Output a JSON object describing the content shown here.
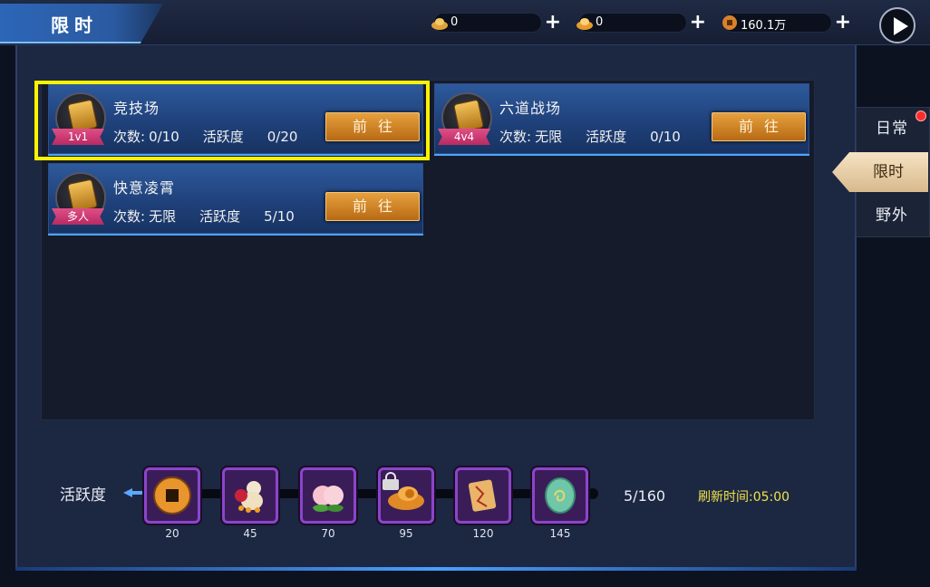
{
  "header": {
    "title": "限时",
    "resources": [
      {
        "icon": "silver-ingot-icon",
        "value": "0"
      },
      {
        "icon": "gold-ingot-icon",
        "value": "0"
      },
      {
        "icon": "coin-icon",
        "value": "160.1万"
      }
    ],
    "plus_label": "+"
  },
  "cards": [
    {
      "name": "arena",
      "title": "竞技场",
      "tag": "1v1",
      "count_label": "次数:",
      "count_value": "0/10",
      "activity_label": "活跃度",
      "activity_value": "0/20",
      "button": "前往"
    },
    {
      "name": "six-paths-battlefield",
      "title": "六道战场",
      "tag": "4v4",
      "count_label": "次数:",
      "count_value": "无限",
      "activity_label": "活跃度",
      "activity_value": "0/10",
      "button": "前往"
    },
    {
      "name": "kuaiyi-lingxiao",
      "title": "快意凌霄",
      "tag": "多人",
      "count_label": "次数:",
      "count_value": "无限",
      "activity_label": "活跃度",
      "activity_value": "5/10",
      "button": "前往"
    }
  ],
  "side_tabs": {
    "daily": "日常",
    "limited": "限时",
    "wild": "野外"
  },
  "activity": {
    "label": "活跃度",
    "progress": "5/160",
    "refresh_label": "刷新时间:",
    "refresh_time": "05:00",
    "rewards": [
      {
        "icon": "copper-coin-icon",
        "threshold": "20"
      },
      {
        "icon": "gourd-icon",
        "threshold": "45"
      },
      {
        "icon": "peach-icon",
        "threshold": "70"
      },
      {
        "icon": "ingot-locked-icon",
        "threshold": "95"
      },
      {
        "icon": "scroll-map-icon",
        "threshold": "120"
      },
      {
        "icon": "jade-orb-icon",
        "threshold": "145"
      }
    ]
  },
  "colors": {
    "highlight": "#fff200",
    "button": "#d88a2a",
    "tag": "#d23c74",
    "refresh_text": "#f0e24a"
  }
}
